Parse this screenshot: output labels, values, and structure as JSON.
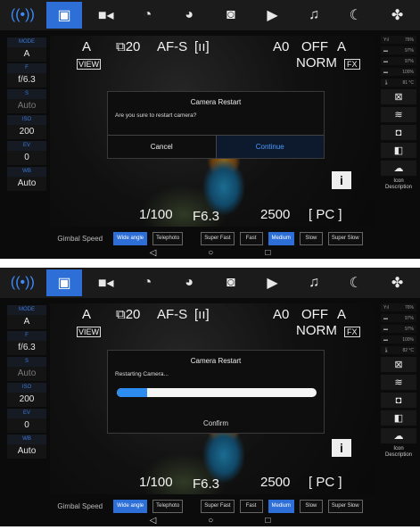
{
  "tabs": [
    {
      "icon": "gimbal-icon",
      "glyph": "((•))"
    },
    {
      "icon": "camera-icon",
      "glyph": "▣"
    },
    {
      "icon": "video-icon",
      "glyph": "■◂"
    },
    {
      "icon": "timer-icon",
      "glyph": "◔"
    },
    {
      "icon": "timelapse-icon",
      "glyph": "◕"
    },
    {
      "icon": "camera-settings-icon",
      "glyph": "◙"
    },
    {
      "icon": "play-icon",
      "glyph": "▶"
    },
    {
      "icon": "music-icon",
      "glyph": "♫"
    },
    {
      "icon": "moon-icon",
      "glyph": "☾"
    },
    {
      "icon": "fan-icon",
      "glyph": "✤"
    }
  ],
  "left_params": [
    {
      "label": "MODE",
      "value": "A"
    },
    {
      "label": "F",
      "value": "f/6.3"
    },
    {
      "label": "S",
      "value": "Auto"
    },
    {
      "label": "ISO",
      "value": "200"
    },
    {
      "label": "EV",
      "value": "0"
    },
    {
      "label": "WB",
      "value": "Auto"
    }
  ],
  "overlay": {
    "mode": "A",
    "shots": "20",
    "af": "AF-S",
    "area": "[ıı]",
    "wb": "A0",
    "drive": "OFF",
    "flash": "A",
    "quality": "NORM",
    "fx": "FX",
    "shutter": "1/100",
    "aperture": "F6.3",
    "iso_display": "2500",
    "pc": "[ PC ]",
    "view": "VIEW"
  },
  "right_stats": [
    {
      "icon": "signal-icon",
      "glyph": "Yıl",
      "pct": "76%"
    },
    {
      "icon": "battery-icon",
      "glyph": "▬",
      "pct": "97%"
    },
    {
      "icon": "battery2-icon",
      "glyph": "▬",
      "pct": "97%"
    },
    {
      "icon": "battery3-icon",
      "glyph": "▬",
      "pct": "100%"
    }
  ],
  "screen1": {
    "temp": "81 °C",
    "dialog": {
      "title": "Camera Restart",
      "message": "Are you sure to restart camera?",
      "cancel": "Cancel",
      "continue": "Continue"
    }
  },
  "screen2": {
    "temp": "82 °C",
    "dialog": {
      "title": "Camera Restart",
      "message": "Restarting Camera...",
      "progress": 0.15,
      "confirm": "Confirm"
    }
  },
  "icon_desc": "Icon Description",
  "gimbal_speed": {
    "label": "Gimbal Speed",
    "options": [
      "Wide angle",
      "Telephoto",
      "Super Fast",
      "Fast",
      "Medium",
      "Slow",
      "Super Slow"
    ],
    "active_indices": [
      0,
      4
    ]
  },
  "nav": [
    "◁",
    "○",
    "□"
  ]
}
